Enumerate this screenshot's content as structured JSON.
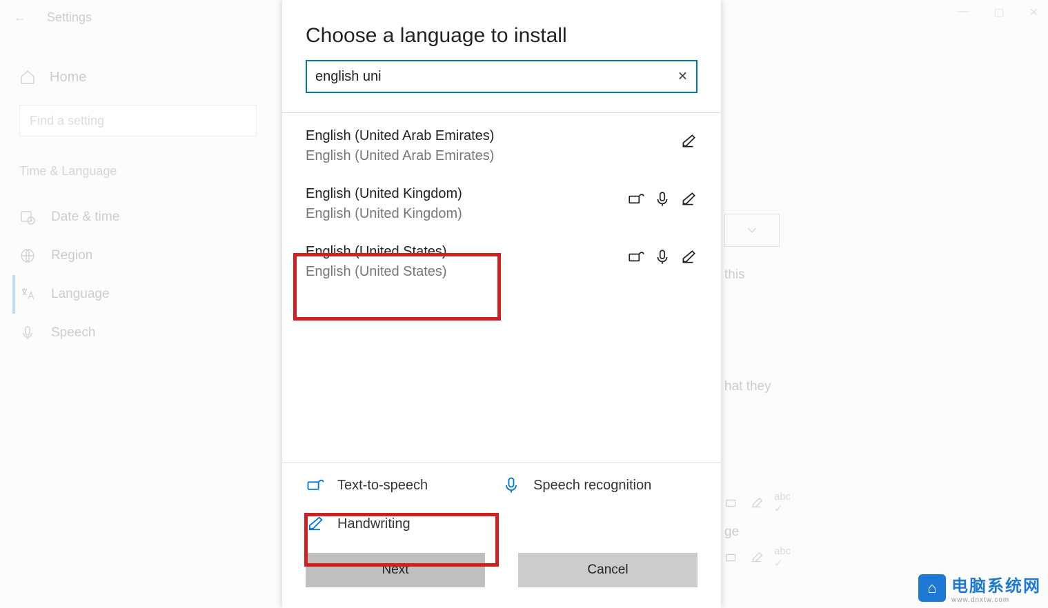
{
  "settings": {
    "title": "Settings",
    "home": "Home",
    "find_placeholder": "Find a setting",
    "category": "Time & Language",
    "nav": {
      "date_time": "Date & time",
      "region": "Region",
      "language": "Language",
      "speech": "Speech"
    }
  },
  "background_partial": {
    "text_this": "this",
    "text_hat_they": "hat they",
    "ge": "ge"
  },
  "dialog": {
    "title": "Choose a language to install",
    "search_value": "english uni",
    "languages": [
      {
        "primary": "English (United Arab Emirates)",
        "secondary": "English (United Arab Emirates)",
        "icons": [
          "handwriting"
        ]
      },
      {
        "primary": "English (United Kingdom)",
        "secondary": "English (United Kingdom)",
        "icons": [
          "tts",
          "speech",
          "handwriting"
        ]
      },
      {
        "primary": "English (United States)",
        "secondary": "English (United States)",
        "icons": [
          "tts",
          "speech",
          "handwriting"
        ]
      }
    ],
    "features": {
      "tts": "Text-to-speech",
      "speech": "Speech recognition",
      "handwriting": "Handwriting"
    },
    "buttons": {
      "next": "Next",
      "cancel": "Cancel"
    }
  },
  "watermark": {
    "brand": "电脑系统网",
    "url": "www.dnxtw.com"
  }
}
